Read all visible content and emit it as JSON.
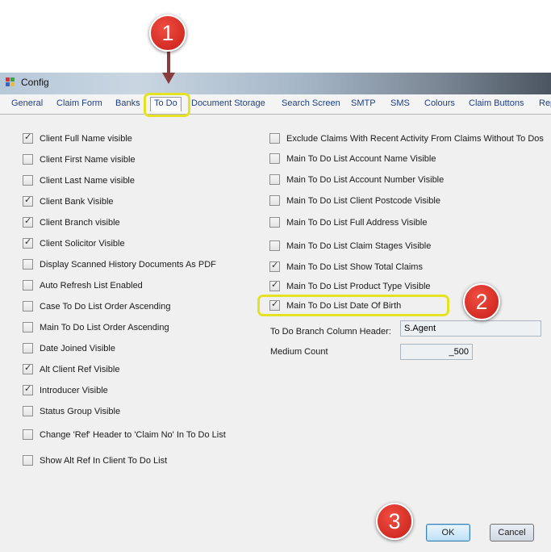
{
  "window": {
    "title": "Config"
  },
  "tabs": [
    "General",
    "Claim Form",
    "Banks",
    "To Do",
    "Document Storage",
    "Search Screen",
    "SMTP",
    "SMS",
    "Colours",
    "Claim Buttons",
    "Rep"
  ],
  "left_options": [
    {
      "label": "Client Full Name visible",
      "checked": true
    },
    {
      "label": "Client First Name visible",
      "checked": false
    },
    {
      "label": "Client Last Name visible",
      "checked": false
    },
    {
      "label": "Client Bank Visible",
      "checked": true
    },
    {
      "label": "Client Branch visible",
      "checked": true
    },
    {
      "label": "Client Solicitor Visible",
      "checked": true
    },
    {
      "label": "Display Scanned History Documents As PDF",
      "checked": false
    },
    {
      "label": "Auto Refresh List Enabled",
      "checked": false
    },
    {
      "label": "Case To Do List Order Ascending",
      "checked": false
    },
    {
      "label": "Main To Do List Order Ascending",
      "checked": false
    },
    {
      "label": "Date Joined Visible",
      "checked": false
    },
    {
      "label": "Alt Client Ref Visible",
      "checked": true
    },
    {
      "label": "Introducer Visible",
      "checked": true
    },
    {
      "label": "Status Group  Visible",
      "checked": false
    },
    {
      "label": "Change 'Ref' Header to 'Claim No' In To Do List",
      "checked": false
    },
    {
      "label": "Show Alt Ref In Client To Do List",
      "checked": false
    }
  ],
  "right_options": [
    {
      "label": "Exclude Claims With Recent Activity From Claims Without To Dos",
      "checked": false
    },
    {
      "label": "Main To Do List Account Name Visible",
      "checked": false
    },
    {
      "label": "Main To Do List Account Number Visible",
      "checked": false
    },
    {
      "label": "Main To Do List Client Postcode Visible",
      "checked": false
    },
    {
      "label": "Main To Do List Full Address Visible",
      "checked": false
    },
    {
      "label": "Main To Do List Claim Stages Visible",
      "checked": false
    },
    {
      "label": "Main To Do List Show Total Claims",
      "checked": true
    },
    {
      "label": "Main To Do List Product Type Visible",
      "checked": true
    },
    {
      "label": "Main To Do List Date Of Birth",
      "checked": true
    }
  ],
  "fields": {
    "branch_header_label": "To Do Branch Column Header:",
    "branch_header_value": "S.Agent",
    "medium_count_label": "Medium Count",
    "medium_count_value": "_500"
  },
  "buttons": {
    "ok": "OK",
    "cancel": "Cancel"
  },
  "callouts": [
    "1",
    "2",
    "3"
  ]
}
